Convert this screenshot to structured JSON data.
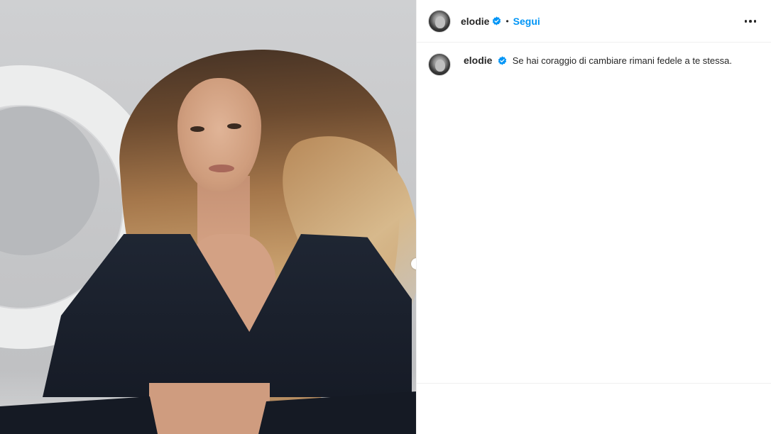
{
  "post": {
    "username": "elodie",
    "separator": "•",
    "follow_label": "Segui",
    "caption": "Se hai coraggio di cambiare rimani fedele a te stessa."
  },
  "icons": {
    "verified": "verified-badge-icon",
    "more": "more-options-icon"
  },
  "colors": {
    "link": "#0095f6",
    "verified": "#0095f6",
    "text": "#262626",
    "divider": "#efefef"
  }
}
